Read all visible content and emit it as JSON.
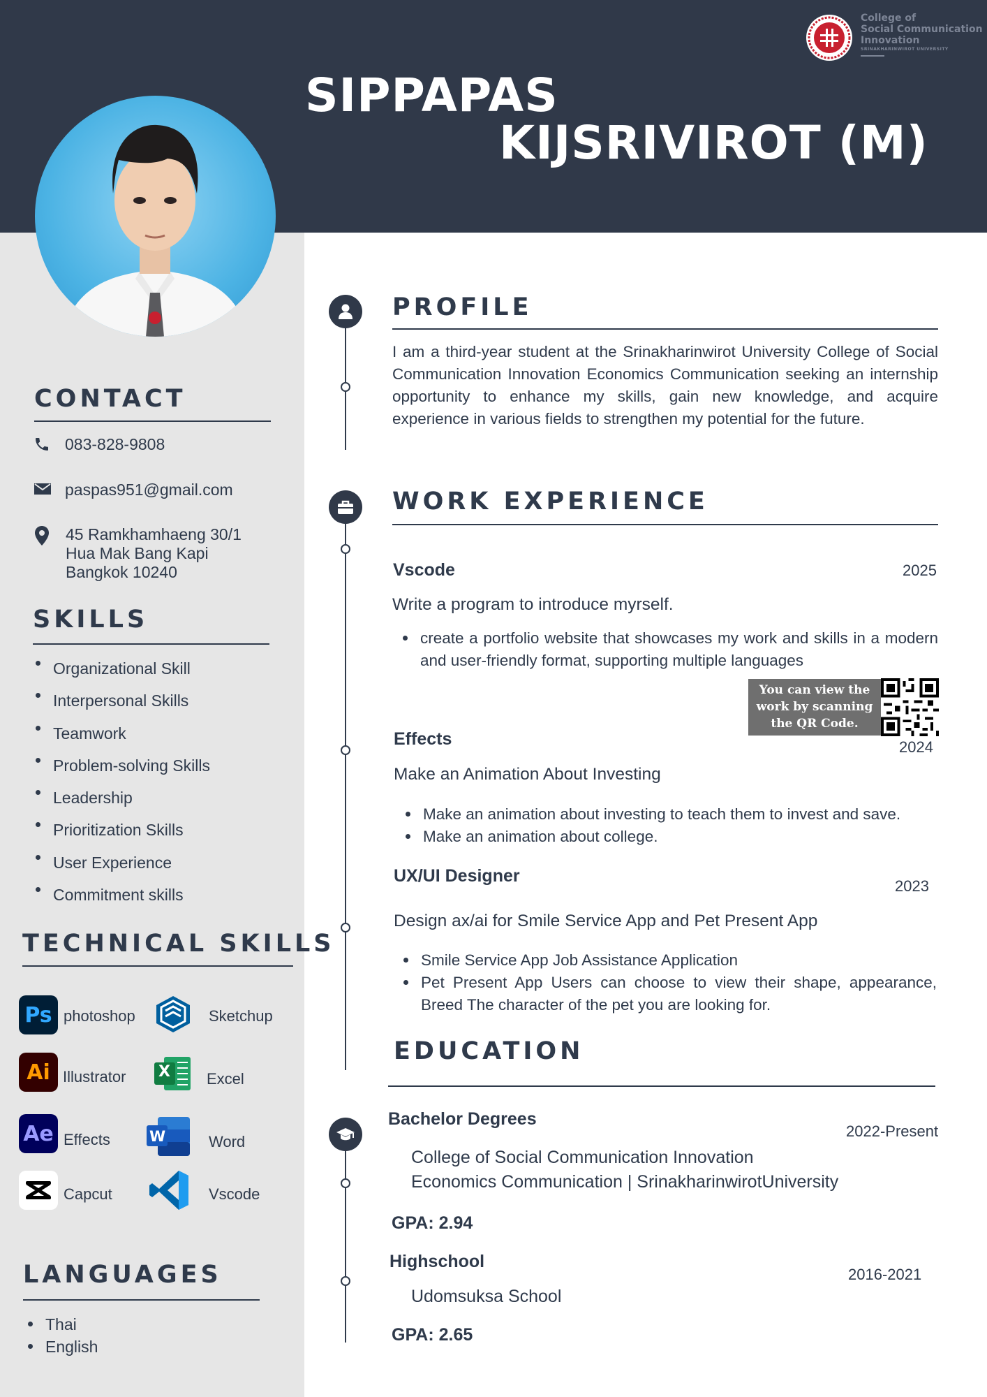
{
  "header": {
    "first_name": "SIPPAPAS",
    "last_name": "KIJSRIVIROT (M)",
    "logo": {
      "line1": "College of",
      "line2": "Social Communication",
      "line3": "Innovation",
      "line4": "SRINAKHARINWIROT UNIVERSITY"
    }
  },
  "contact": {
    "title": "CONTACT",
    "phone": "083-828-9808",
    "email": "paspas951@gmail.com",
    "address": [
      "45 Ramkhamhaeng 30/1",
      "Hua Mak  Bang Kapi",
      "Bangkok 10240"
    ]
  },
  "skills": {
    "title": "SKILLS",
    "items": [
      "Organizational Skill",
      "Interpersonal Skills",
      "Teamwork",
      "Problem-solving Skills",
      "Leadership",
      "Prioritization Skills",
      "User Experience",
      "Commitment skills"
    ]
  },
  "technical": {
    "title": "TECHNICAL SKILLS",
    "items": [
      {
        "icon_text": "Ps",
        "label": "photoshop"
      },
      {
        "icon_text": "",
        "label": "Sketchup"
      },
      {
        "icon_text": "Ai",
        "label": "Illustrator"
      },
      {
        "icon_text": "X",
        "label": "Excel"
      },
      {
        "icon_text": "Ae",
        "label": "Effects"
      },
      {
        "icon_text": "W",
        "label": "Word"
      },
      {
        "icon_text": "",
        "label": "Capcut"
      },
      {
        "icon_text": "",
        "label": "Vscode"
      }
    ]
  },
  "languages": {
    "title": "LANGUAGES",
    "items": [
      "Thai",
      "English"
    ]
  },
  "profile": {
    "title": "PROFILE",
    "text": "I am a third-year student at the Srinakharinwirot University College of Social Communication Innovation Economics Communication seeking an internship opportunity to enhance my skills, gain new knowledge, and acquire experience in various fields to strengthen my potential for the future."
  },
  "work": {
    "title": "WORK EXPERIENCE",
    "jobs": [
      {
        "name": "Vscode",
        "year": "2025",
        "desc": "Write a program to introduce myrself.",
        "bullets": [
          "create a portfolio website that showcases my work and skills in a modern and user-friendly format, supporting multiple languages"
        ]
      },
      {
        "name": "Effects",
        "year": "2024",
        "desc": "Make an Animation About Investing",
        "bullets": [
          "Make an animation about investing to teach them to invest and save.",
          "Make an animation about college."
        ]
      },
      {
        "name": "UX/UI Designer",
        "year": "2023",
        "desc": "Design ax/ai for Smile Service App and Pet Present App",
        "bullets": [
          "Smile Service App Job Assistance Application",
          "Pet Present App Users can choose to view their shape, appearance, Breed The character of the pet you are looking for."
        ]
      }
    ],
    "qr_note": [
      "You can view the",
      "work by scanning",
      "the QR Code."
    ]
  },
  "education": {
    "title": "EDUCATION",
    "entries": [
      {
        "level": "Bachelor Degrees",
        "year": "2022-Present",
        "lines": [
          "College of Social Communication Innovation",
          "Economics Communication  | SrinakharinwirotUniversity"
        ],
        "gpa": "GPA: 2.94"
      },
      {
        "level": "Highschool",
        "year": "2016-2021",
        "lines": [
          "Udomsuksa School"
        ],
        "gpa": "GPA: 2.65"
      }
    ]
  }
}
